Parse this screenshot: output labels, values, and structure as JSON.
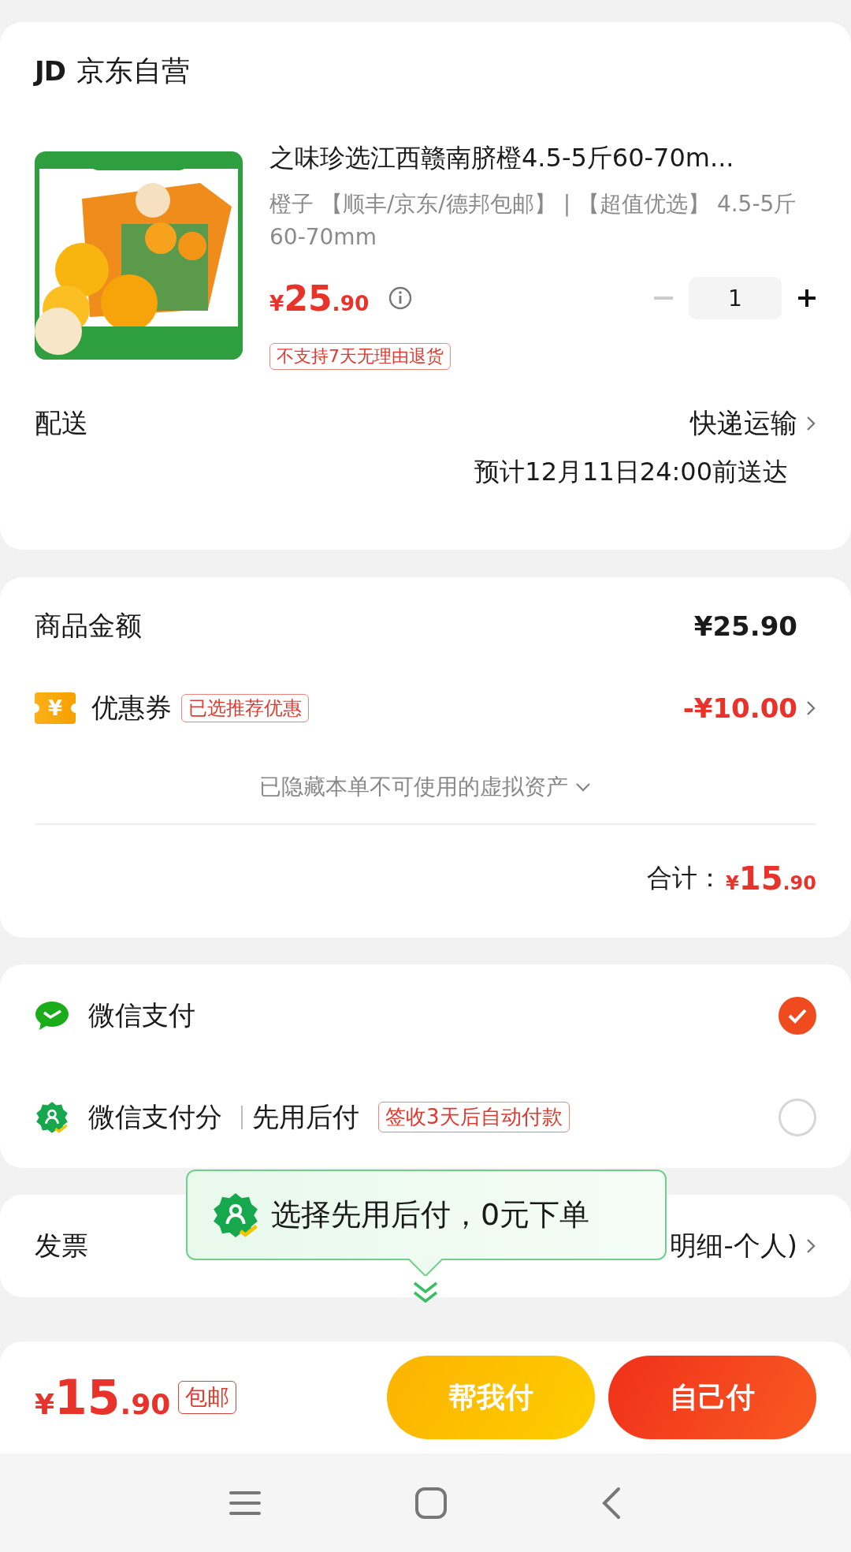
{
  "store": {
    "logo": "JD",
    "name": "京东自营"
  },
  "product": {
    "image": {
      "kind": "picture"
    },
    "title": "之味珍选江西赣南脐橙4.5-5斤60-70m...",
    "specs": "橙子 【顺丰/京东/德邦包邮】 | 【超值优选】 4.5-5斤60-70mm",
    "price": {
      "currency": "¥",
      "integer": "25",
      "decimal": ".90"
    },
    "quantity": "1",
    "tags": [
      "不支持7天无理由退货"
    ]
  },
  "delivery": {
    "label": "配送",
    "method": "快递运输",
    "estimate": "预计12月11日24:00前送达"
  },
  "summary": {
    "goods_label": "商品金额",
    "goods_amount": "¥25.90",
    "coupon": {
      "icon_text": "¥",
      "label": "优惠券",
      "tag": "已选推荐优惠",
      "amount": "-¥10.00"
    },
    "hidden_note": "已隐藏本单不可使用的虚拟资产",
    "total_label": "合计：",
    "total": {
      "currency": "¥",
      "integer": "15",
      "decimal": ".90"
    }
  },
  "payment_methods": [
    {
      "kind": "wechat",
      "name": "微信支付",
      "selected": true
    },
    {
      "kind": "payscore",
      "name": "微信支付分",
      "subtitle": "先用后付",
      "tag": "签收3天后自动付款",
      "selected": false
    }
  ],
  "invoice": {
    "label": "发票",
    "value": "明细-个人)"
  },
  "tooltip": {
    "text": "选择先用后付，0元下单"
  },
  "bottom_bar": {
    "total": {
      "currency": "¥",
      "integer": "15",
      "decimal": ".90"
    },
    "shipping_tag": "包邮",
    "buttons": [
      {
        "kind": "secondary",
        "label": "帮我付"
      },
      {
        "kind": "primary",
        "label": "自己付"
      }
    ]
  }
}
